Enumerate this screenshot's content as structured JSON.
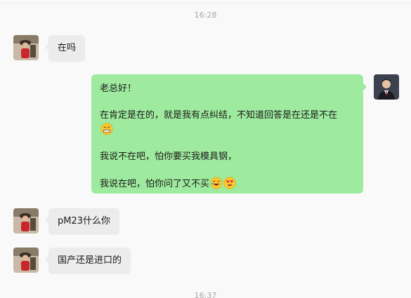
{
  "timestamps": {
    "top": "16:28",
    "bottom": "16:37"
  },
  "messages": {
    "m1": {
      "text": "在吗"
    },
    "m2": {
      "line1": "老总好！",
      "line2": "在肯定是在的，就是我有点纠结，不知道回答是在还是不在",
      "line3": "我说不在吧，怕你要买我模具钢，",
      "line4": "我说在吧，怕你问了又不买"
    },
    "m3": {
      "text": "pM23什么你"
    },
    "m4": {
      "text": "国产还是进口的"
    }
  },
  "emojis": {
    "grin": "grinning-face-icon",
    "laugh": "rolling-laughing-face-icon",
    "heart_eyes": "heart-eyes-face-icon"
  },
  "colors": {
    "outgoing_bubble": "#9eea9e",
    "incoming_bubble": "#ececec",
    "background": "#f9f9f9"
  }
}
